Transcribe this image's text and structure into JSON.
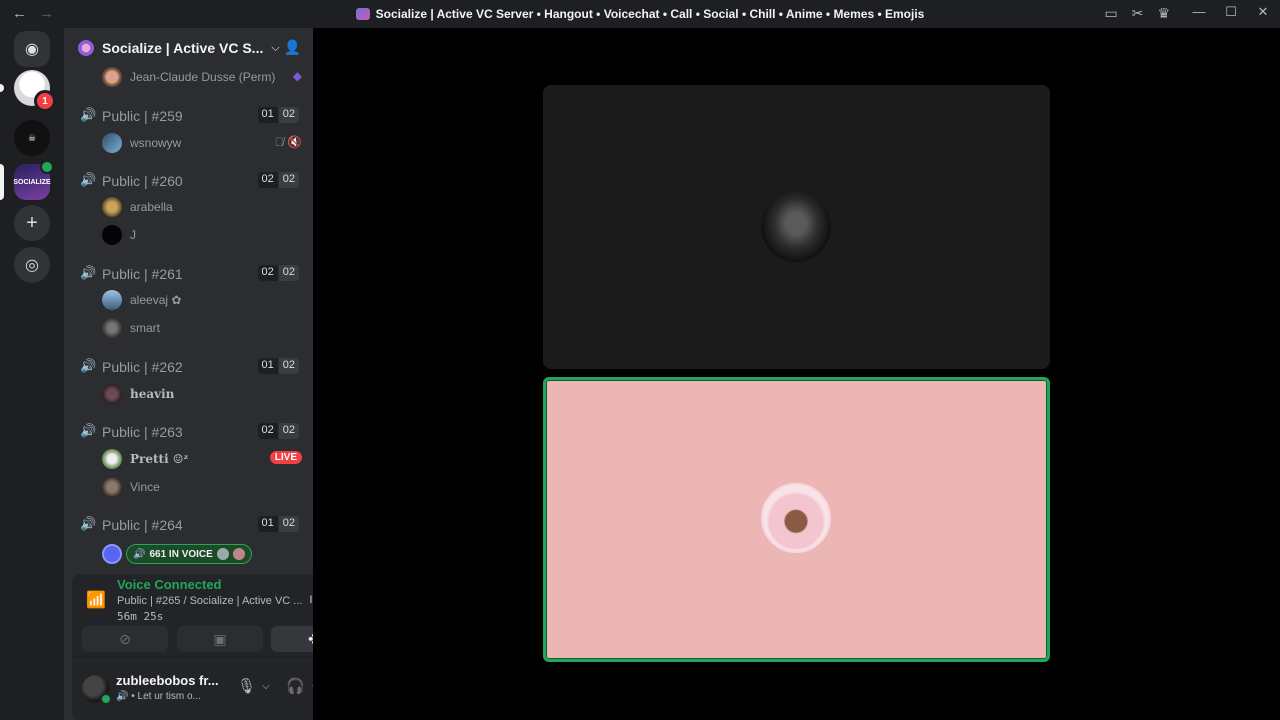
{
  "window": {
    "title": "Socialize | Active VC Server • Hangout • Voicechat • Call • Social • Chill • Anime • Memes • Emojis",
    "back_glyph": "←",
    "forward_glyph": "→",
    "tools": [
      "inbox-icon",
      "tools-icon",
      "nitro-icon"
    ],
    "controls": {
      "minimize": "—",
      "maximize": "☐",
      "close": "✕"
    }
  },
  "rail": {
    "server1_badge": "1",
    "server2_label": "☠",
    "server3_label": "SOCIALIZE",
    "add_glyph": "+",
    "explore_glyph": "◎"
  },
  "server": {
    "name": "Socialize | Active VC S...",
    "chevron": "⌵",
    "invite_glyph": "👤"
  },
  "channels": [
    {
      "name": "Public | #259",
      "count": "01",
      "limit": "02",
      "users": [
        {
          "name": "wsnowyw",
          "icons": "🎙̸ 🔇"
        }
      ]
    },
    {
      "name": "Public | #260",
      "count": "02",
      "limit": "02",
      "users": [
        {
          "name": "arabella"
        },
        {
          "name": "J"
        }
      ]
    },
    {
      "name": "Public | #261",
      "count": "02",
      "limit": "02",
      "users": [
        {
          "name": "aleevaj ✿"
        },
        {
          "name": "smart"
        }
      ]
    },
    {
      "name": "Public | #262",
      "count": "01",
      "limit": "02",
      "users": [
        {
          "name": "heavin"
        }
      ]
    },
    {
      "name": "Public | #263",
      "count": "02",
      "limit": "02",
      "users": [
        {
          "name": "Pretti ☺ᶻ",
          "live": "LIVE"
        },
        {
          "name": "Vince"
        }
      ]
    },
    {
      "name": "Public | #264",
      "count": "01",
      "limit": "02"
    }
  ],
  "top_user": "Jean-Claude Dusse (Perm)",
  "in_voice": {
    "label": "661 IN VOICE",
    "speaker": "🔊"
  },
  "voice": {
    "status": "Voice Connected",
    "channel": "Public | #265 / Socialize | Active VC ...",
    "elapsed": "56m 25s",
    "signal_glyph": "📶",
    "noise_glyph": "ılıl",
    "hangup_glyph": "☎",
    "buttons": [
      "camera-off-icon",
      "screen-share-icon",
      "activities-icon"
    ]
  },
  "me": {
    "name": "zubleebobos fr...",
    "custom_status": "Let ur tism o..."
  },
  "colors": {
    "online": "#23a55a",
    "live": "#f23f43",
    "tile_pink": "#ecb6b4",
    "tile_dark": "#1b1b1c"
  }
}
